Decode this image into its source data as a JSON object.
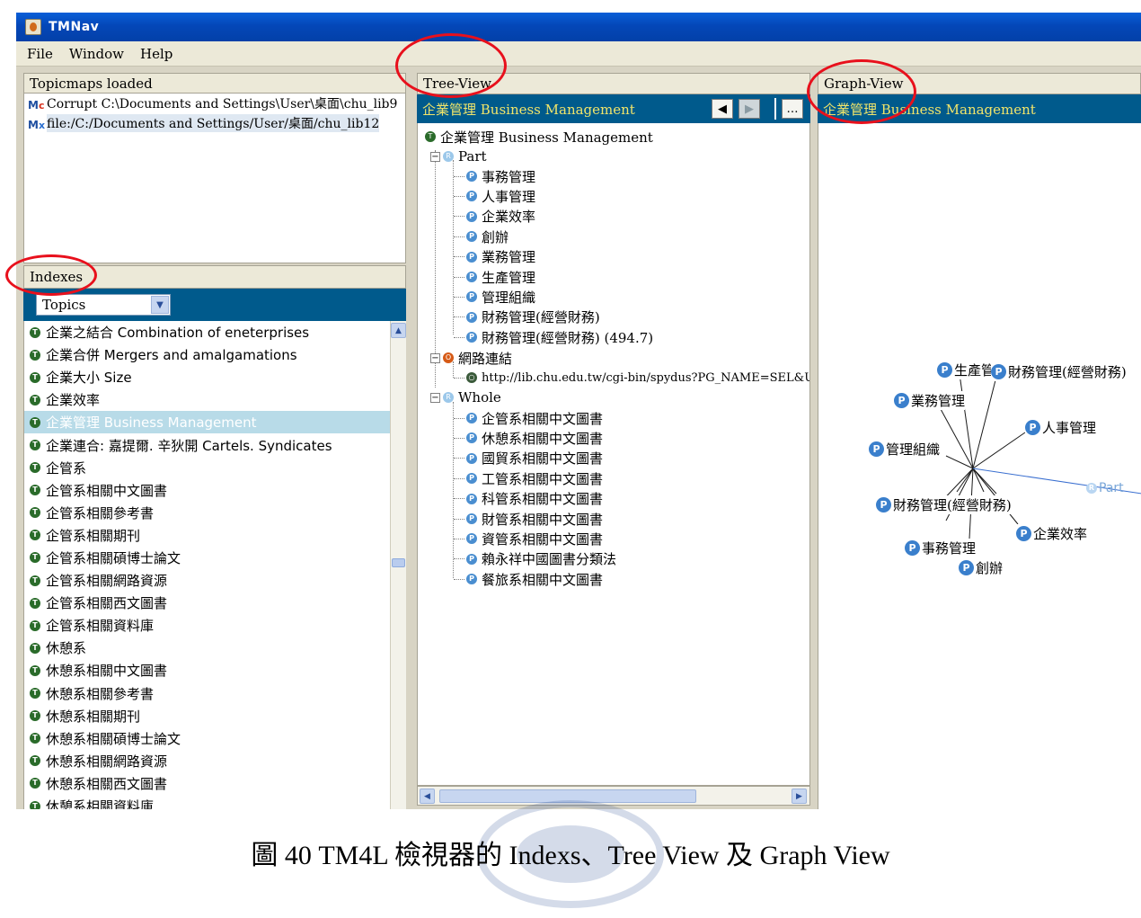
{
  "window": {
    "title": "TMNav"
  },
  "menu": [
    "File",
    "Window",
    "Help"
  ],
  "topicmaps": {
    "header": "Topicmaps loaded",
    "items": [
      {
        "label": "Corrupt C:\\Documents and Settings\\User\\桌面\\chu_lib9"
      },
      {
        "label": "file:/C:/Documents and Settings/User/桌面/chu_lib12"
      }
    ]
  },
  "indexes": {
    "header": "Indexes",
    "selected_type": "Topics",
    "selected_index": 4,
    "items": [
      "企業之結合 Combination of eneterprises",
      "企業合併 Mergers and amalgamations",
      "企業大小 Size",
      "企業效率",
      "企業管理 Business Management",
      "企業連合: 嘉提爾. 辛狄開 Cartels. Syndicates",
      "企管系",
      "企管系相關中文圖書",
      "企管系相關參考書",
      "企管系相關期刊",
      "企管系相關碩博士論文",
      "企管系相關網路資源",
      "企管系相關西文圖書",
      "企管系相關資料庫",
      "休憩系",
      "休憩系相關中文圖書",
      "休憩系相關參考書",
      "休憩系相關期刊",
      "休憩系相關碩博士論文",
      "休憩系相關網路資源",
      "休憩系相關西文圖書",
      "休憩系相關資料庫"
    ]
  },
  "tree_view": {
    "header": "Tree-View",
    "bar_title": "企業管理 Business Management",
    "root": "企業管理 Business Management",
    "part": {
      "label": "Part",
      "children": [
        "事務管理",
        "人事管理",
        "企業效率",
        "創辦",
        "業務管理",
        "生產管理",
        "管理組織",
        "財務管理(經營財務)",
        "財務管理(經營財務) (494.7)"
      ]
    },
    "links": {
      "label": "網路連結",
      "children": [
        "http://lib.chu.edu.tw/cgi-bin/spydus?PG_NAME=SEL&U"
      ]
    },
    "whole": {
      "label": "Whole",
      "children": [
        "企管系相關中文圖書",
        "休憩系相關中文圖書",
        "國貿系相關中文圖書",
        "工管系相關中文圖書",
        "科管系相關中文圖書",
        "財管系相關中文圖書",
        "資管系相關中文圖書",
        "賴永祥中國圖書分類法",
        "餐旅系相關中文圖書"
      ]
    }
  },
  "graph_view": {
    "header": "Graph-View",
    "bar_title": "企業管理 Business Management",
    "nodes": {
      "n1": "生產管理",
      "n2": "財務管理(經營財務)",
      "n3": "業務管理",
      "n4": "人事管理",
      "n5": "管理組織",
      "n6": "財務管理(經營財務)",
      "n7": "企業效率",
      "n8": "事務管理",
      "n9": "創辦",
      "part": "Part"
    }
  },
  "caption": "圖 40 TM4L 檢視器的 Indexs、Tree View 及 Graph View",
  "colors": {
    "bar": "#005a8c",
    "bar_text": "#f0e46a",
    "annotation": "#e8101c"
  }
}
